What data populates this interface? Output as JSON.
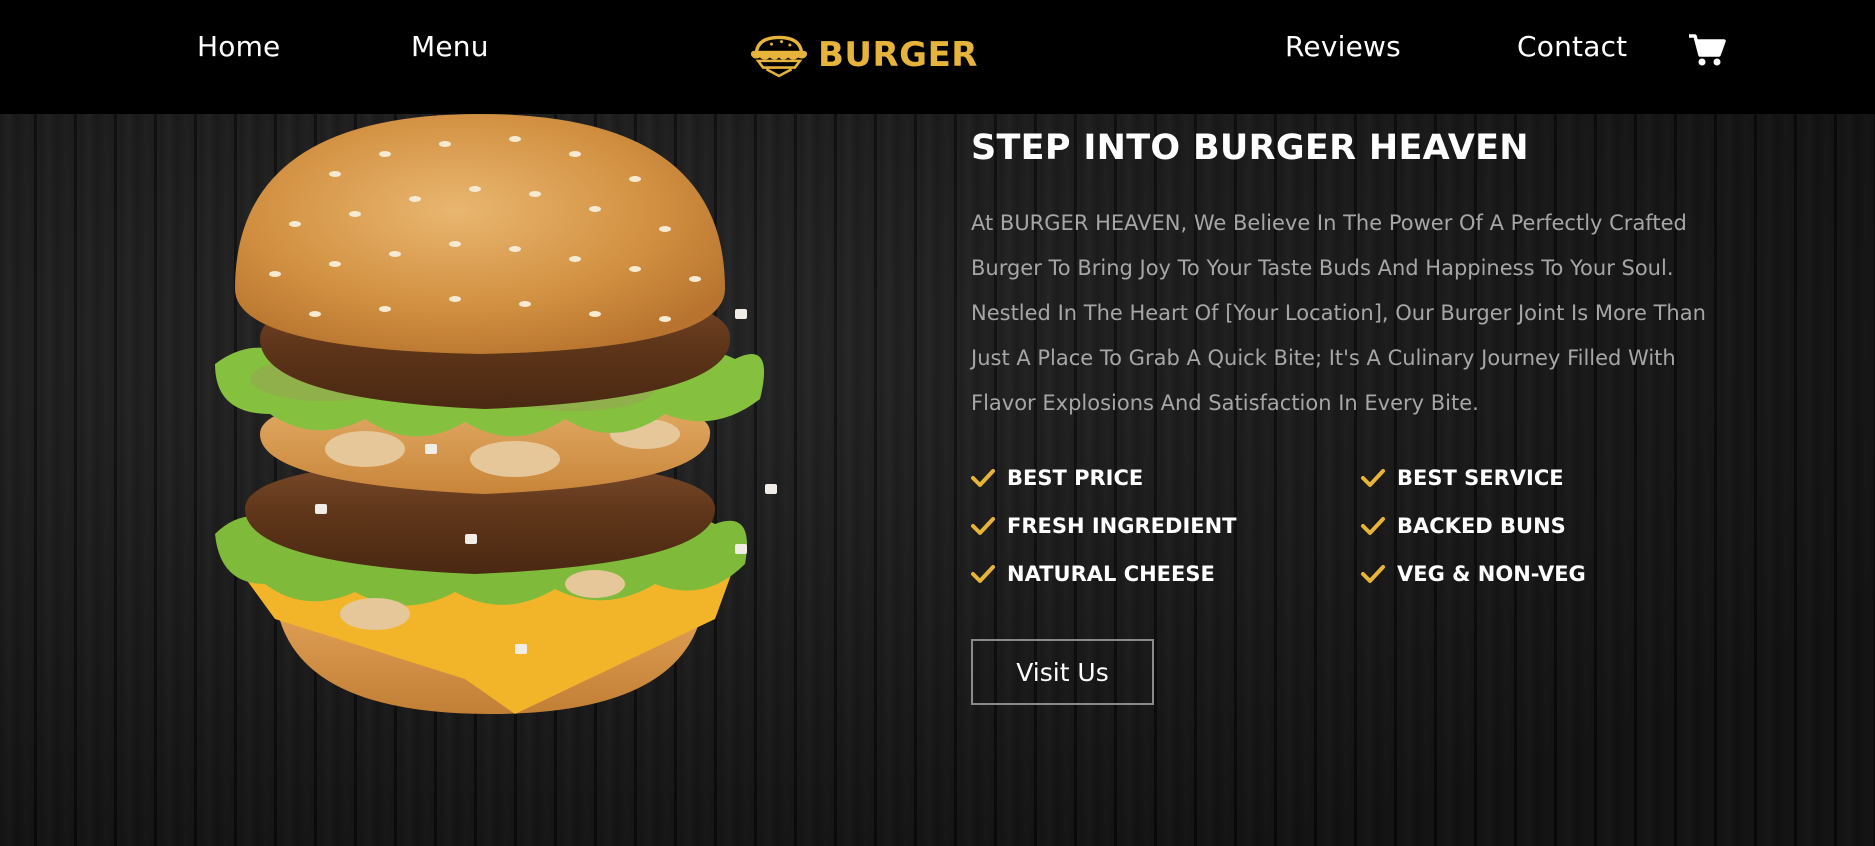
{
  "nav": {
    "home": "Home",
    "menu": "Menu",
    "reviews": "Reviews",
    "contact": "Contact"
  },
  "logo": {
    "text": "BURGER"
  },
  "icons": {
    "cart": "cart-icon",
    "logo": "burger-logo-icon",
    "check": "check-icon"
  },
  "colors": {
    "accent": "#e6b43a",
    "header_bg": "#000000",
    "text_muted": "#a6a6a6"
  },
  "hero": {
    "heading": "STEP INTO BURGER HEAVEN",
    "paragraph": "At BURGER HEAVEN, We Believe In The Power Of A Perfectly Crafted Burger To Bring Joy To Your Taste Buds And Happiness To Your Soul. Nestled In The Heart Of [Your Location], Our Burger Joint Is More Than Just A Place To Grab A Quick Bite; It's A Culinary Journey Filled With Flavor Explosions And Satisfaction In Every Bite.",
    "features": [
      "BEST PRICE",
      "BEST SERVICE",
      "FRESH INGREDIENT",
      "BACKED BUNS",
      "NATURAL CHEESE",
      "VEG & NON-VEG"
    ],
    "button_label": "Visit Us"
  }
}
